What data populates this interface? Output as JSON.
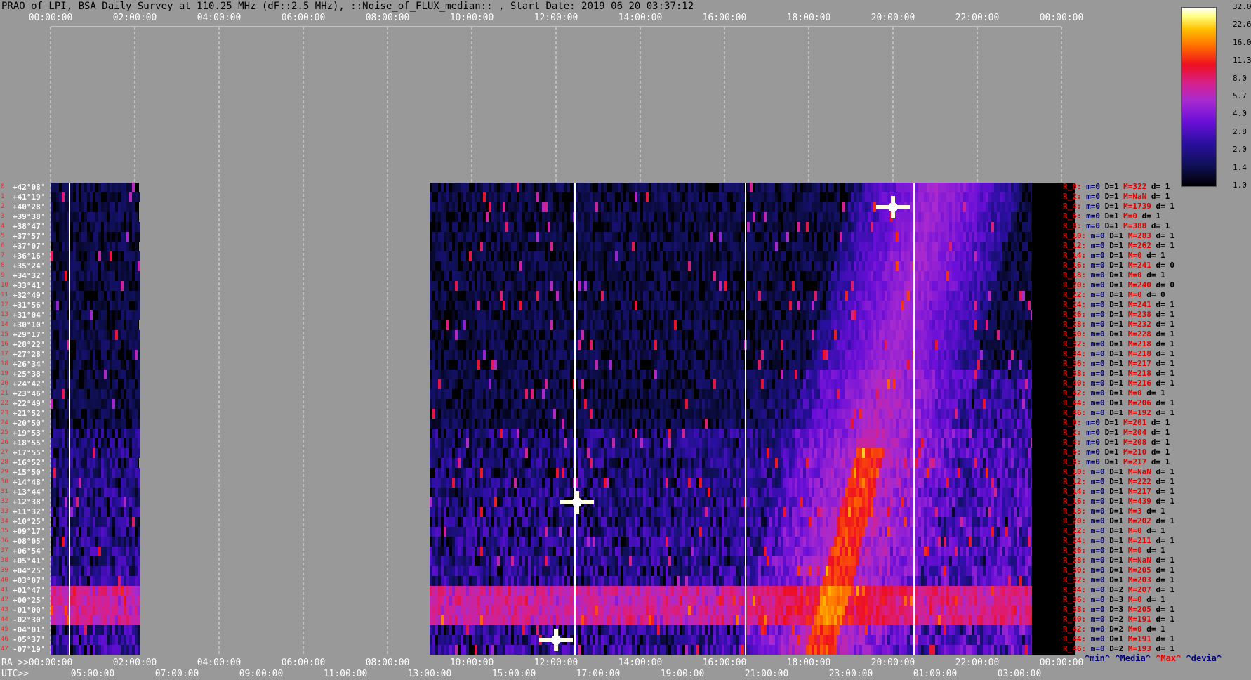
{
  "header": {
    "title": "PRAO of LPI, BSA Daily Survey at 110.25 MHz (dF::2.5 MHz), ::Noise_of_FLUX_median:: , Start Date: 2019 06 20 03:37:12"
  },
  "axes": {
    "top_ticks": [
      "00:00:00",
      "02:00:00",
      "04:00:00",
      "06:00:00",
      "08:00:00",
      "10:00:00",
      "12:00:00",
      "14:00:00",
      "16:00:00",
      "18:00:00",
      "20:00:00",
      "22:00:00",
      "00:00:00"
    ],
    "ra_label": "RA >>",
    "ra_ticks": [
      "00:00:00",
      "02:00:00",
      "04:00:00",
      "06:00:00",
      "08:00:00",
      "10:00:00",
      "12:00:00",
      "14:00:00",
      "16:00:00",
      "18:00:00",
      "20:00:00",
      "22:00:00",
      "00:00:00"
    ],
    "utc_label": "UTC>>",
    "utc_ticks": [
      "05:00:00",
      "07:00:00",
      "09:00:00",
      "11:00:00",
      "13:00:00",
      "15:00:00",
      "17:00:00",
      "19:00:00",
      "21:00:00",
      "23:00:00",
      "01:00:00",
      "03:00:00"
    ]
  },
  "declinations": [
    "+42°08'",
    "+41°19'",
    "+40°28'",
    "+39°38'",
    "+38°47'",
    "+37°57'",
    "+37°07'",
    "+36°16'",
    "+35°24'",
    "+34°32'",
    "+33°41'",
    "+32°49'",
    "+31°56'",
    "+31°04'",
    "+30°10'",
    "+29°17'",
    "+28°22'",
    "+27°28'",
    "+26°34'",
    "+25°38'",
    "+24°42'",
    "+23°46'",
    "+22°49'",
    "+21°52'",
    "+20°50'",
    "+19°53'",
    "+18°55'",
    "+17°55'",
    "+16°52'",
    "+15°50'",
    "+14°48'",
    "+13°44'",
    "+12°38'",
    "+11°32'",
    "+10°25'",
    "+09°17'",
    "+08°05'",
    "+06°54'",
    "+05°41'",
    "+04°25'",
    "+03°07'",
    "+01°47'",
    "+00°25'",
    "-01°00'",
    "-02°30'",
    "-04°01'",
    "-05°37'",
    "-07°19'"
  ],
  "colorbar": {
    "ticks": [
      "32.0",
      "22.6",
      "16.0",
      "11.3",
      "8.0",
      "5.7",
      "4.0",
      "2.8",
      "2.0",
      "1.4",
      "1.0"
    ]
  },
  "stats": [
    {
      "r": "R_0:",
      "m": "m=0",
      "d": "D=1",
      "M": "M=322",
      "dd": "d= 1"
    },
    {
      "r": "R_2:",
      "m": "m=0",
      "d": "D=1",
      "M": "M=NaN",
      "dd": "d= 1"
    },
    {
      "r": "R_4:",
      "m": "m=0",
      "d": "D=1",
      "M": "M=1739",
      "dd": "d= 1"
    },
    {
      "r": "R_6:",
      "m": "m=0",
      "d": "D=1",
      "M": "M=0",
      "dd": "d= 1"
    },
    {
      "r": "R_8:",
      "m": "m=0",
      "d": "D=1",
      "M": "M=388",
      "dd": "d= 1"
    },
    {
      "r": "R_10:",
      "m": "m=0",
      "d": "D=1",
      "M": "M=283",
      "dd": "d= 1"
    },
    {
      "r": "R_12:",
      "m": "m=0",
      "d": "D=1",
      "M": "M=262",
      "dd": "d= 1"
    },
    {
      "r": "R_14:",
      "m": "m=0",
      "d": "D=1",
      "M": "M=0",
      "dd": "d= 1"
    },
    {
      "r": "R_16:",
      "m": "m=0",
      "d": "D=1",
      "M": "M=241",
      "dd": "d= 0"
    },
    {
      "r": "R_18:",
      "m": "m=0",
      "d": "D=1",
      "M": "M=0",
      "dd": "d= 1"
    },
    {
      "r": "R_20:",
      "m": "m=0",
      "d": "D=1",
      "M": "M=240",
      "dd": "d= 0"
    },
    {
      "r": "R_22:",
      "m": "m=0",
      "d": "D=1",
      "M": "M=0",
      "dd": "d= 0"
    },
    {
      "r": "R_24:",
      "m": "m=0",
      "d": "D=1",
      "M": "M=241",
      "dd": "d= 1"
    },
    {
      "r": "R_26:",
      "m": "m=0",
      "d": "D=1",
      "M": "M=238",
      "dd": "d= 1"
    },
    {
      "r": "R_28:",
      "m": "m=0",
      "d": "D=1",
      "M": "M=232",
      "dd": "d= 1"
    },
    {
      "r": "R_30:",
      "m": "m=0",
      "d": "D=1",
      "M": "M=228",
      "dd": "d= 1"
    },
    {
      "r": "R_32:",
      "m": "m=0",
      "d": "D=1",
      "M": "M=218",
      "dd": "d= 1"
    },
    {
      "r": "R_34:",
      "m": "m=0",
      "d": "D=1",
      "M": "M=218",
      "dd": "d= 1"
    },
    {
      "r": "R_36:",
      "m": "m=0",
      "d": "D=1",
      "M": "M=217",
      "dd": "d= 1"
    },
    {
      "r": "R_38:",
      "m": "m=0",
      "d": "D=1",
      "M": "M=218",
      "dd": "d= 1"
    },
    {
      "r": "R_40:",
      "m": "m=0",
      "d": "D=1",
      "M": "M=216",
      "dd": "d= 1"
    },
    {
      "r": "R_42:",
      "m": "m=0",
      "d": "D=1",
      "M": "M=0",
      "dd": "d= 1"
    },
    {
      "r": "R_44:",
      "m": "m=0",
      "d": "D=1",
      "M": "M=206",
      "dd": "d= 1"
    },
    {
      "r": "R_46:",
      "m": "m=0",
      "d": "D=1",
      "M": "M=192",
      "dd": "d= 1"
    },
    {
      "r": "R_0:",
      "m": "m=0",
      "d": "D=1",
      "M": "M=201",
      "dd": "d= 1"
    },
    {
      "r": "R_2:",
      "m": "m=0",
      "d": "D=1",
      "M": "M=204",
      "dd": "d= 1"
    },
    {
      "r": "R_4:",
      "m": "m=0",
      "d": "D=1",
      "M": "M=208",
      "dd": "d= 1"
    },
    {
      "r": "R_6:",
      "m": "m=0",
      "d": "D=1",
      "M": "M=210",
      "dd": "d= 1"
    },
    {
      "r": "R_8:",
      "m": "m=0",
      "d": "D=1",
      "M": "M=217",
      "dd": "d= 1"
    },
    {
      "r": "R_10:",
      "m": "m=0",
      "d": "D=1",
      "M": "M=NaN",
      "dd": "d= 1"
    },
    {
      "r": "R_12:",
      "m": "m=0",
      "d": "D=1",
      "M": "M=222",
      "dd": "d= 1"
    },
    {
      "r": "R_14:",
      "m": "m=0",
      "d": "D=1",
      "M": "M=217",
      "dd": "d= 1"
    },
    {
      "r": "R_16:",
      "m": "m=0",
      "d": "D=1",
      "M": "M=439",
      "dd": "d= 1"
    },
    {
      "r": "R_18:",
      "m": "m=0",
      "d": "D=1",
      "M": "M=3",
      "dd": "d= 1"
    },
    {
      "r": "R_20:",
      "m": "m=0",
      "d": "D=1",
      "M": "M=202",
      "dd": "d= 1"
    },
    {
      "r": "R_22:",
      "m": "m=0",
      "d": "D=1",
      "M": "M=0",
      "dd": "d= 1"
    },
    {
      "r": "R_24:",
      "m": "m=0",
      "d": "D=1",
      "M": "M=211",
      "dd": "d= 1"
    },
    {
      "r": "R_26:",
      "m": "m=0",
      "d": "D=1",
      "M": "M=0",
      "dd": "d= 1"
    },
    {
      "r": "R_28:",
      "m": "m=0",
      "d": "D=1",
      "M": "M=NaN",
      "dd": "d= 1"
    },
    {
      "r": "R_30:",
      "m": "m=0",
      "d": "D=1",
      "M": "M=205",
      "dd": "d= 1"
    },
    {
      "r": "R_32:",
      "m": "m=0",
      "d": "D=1",
      "M": "M=203",
      "dd": "d= 1"
    },
    {
      "r": "R_34:",
      "m": "m=0",
      "d": "D=2",
      "M": "M=207",
      "dd": "d= 1"
    },
    {
      "r": "R_36:",
      "m": "m=0",
      "d": "D=3",
      "M": "M=0",
      "dd": "d= 1"
    },
    {
      "r": "R_38:",
      "m": "m=0",
      "d": "D=3",
      "M": "M=205",
      "dd": "d= 1"
    },
    {
      "r": "R_40:",
      "m": "m=0",
      "d": "D=2",
      "M": "M=191",
      "dd": "d= 1"
    },
    {
      "r": "R_42:",
      "m": "m=0",
      "d": "D=2",
      "M": "M=0",
      "dd": "d= 1"
    },
    {
      "r": "R_44:",
      "m": "m=0",
      "d": "D=1",
      "M": "M=191",
      "dd": "d= 1"
    },
    {
      "r": "R_46:",
      "m": "m=0",
      "d": "D=2",
      "M": "M=193",
      "dd": "d= 1"
    }
  ],
  "legend": {
    "min": "^min^",
    "median": "^Media^",
    "max": "^Max^",
    "dev": "^devia^"
  },
  "chart_data": {
    "type": "heatmap",
    "title": "PRAO of LPI, BSA Daily Survey at 110.25 MHz (dF::2.5 MHz), ::Noise_of_FLUX_median:: , Start Date: 2019 06 20 03:37:12",
    "xlabel": "RA >> / UTC>>",
    "ylabel": "",
    "x_range_hours_ra": [
      0,
      24
    ],
    "data_segments_ra_hours": [
      [
        0,
        2.1
      ],
      [
        9.0,
        23.3
      ]
    ],
    "color_scale": {
      "type": "log",
      "min": 1.0,
      "max": 32.0,
      "colors": [
        "#000000",
        "#2a0fa0",
        "#a82ad0",
        "#ee1020",
        "#ffc000",
        "#ffffff"
      ]
    },
    "rows": 48,
    "features": [
      {
        "desc": "bright source",
        "ra_hours": 20.0,
        "dec_row": 2,
        "value": 32
      },
      {
        "desc": "bright source",
        "ra_hours": 12.5,
        "dec_row": 32,
        "value": 22
      },
      {
        "desc": "bright source",
        "ra_hours": 12.0,
        "dec_row": 46,
        "value": 32
      },
      {
        "desc": "galactic plane band",
        "ra_hours_range": [
          17.5,
          21.0
        ],
        "value": 6
      },
      {
        "desc": "horizontal RFI band",
        "dec_rows": [
          42,
          44
        ],
        "value": 6
      }
    ]
  }
}
